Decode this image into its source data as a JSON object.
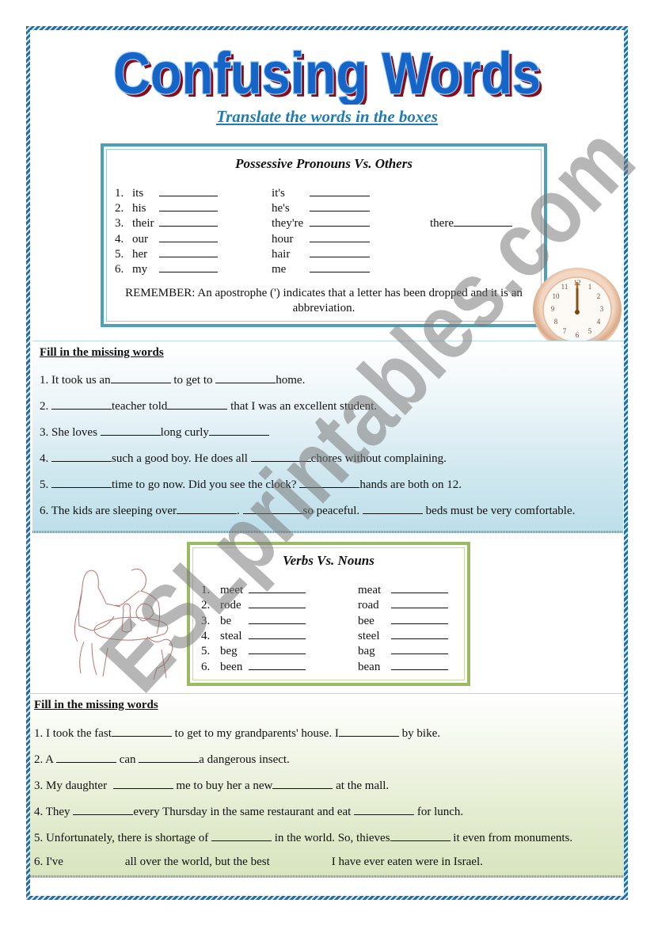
{
  "title": "Confusing Words",
  "subtitle": "Translate the words in the boxes",
  "box1": {
    "heading": "Possessive Pronouns Vs. Others",
    "rows": [
      {
        "num": "1.",
        "left": "its",
        "right": "it's",
        "extra": ""
      },
      {
        "num": "2.",
        "left": "his",
        "right": "he's",
        "extra": ""
      },
      {
        "num": "3.",
        "left": "their",
        "right": "they're",
        "extra": "there"
      },
      {
        "num": "4.",
        "left": "our",
        "right": "hour",
        "extra": ""
      },
      {
        "num": "5.",
        "left": "her",
        "right": "hair",
        "extra": ""
      },
      {
        "num": "6.",
        "left": "my",
        "right": "me",
        "extra": ""
      }
    ],
    "remember": "REMEMBER: An apostrophe (') indicates that a letter has been dropped and it is an abbreviation."
  },
  "clock": {
    "icon": "wall-clock-icon",
    "time": "12:00"
  },
  "fill1": {
    "heading": "Fill in the missing words",
    "sentences": [
      [
        "1. It took us an",
        "_",
        " to get to ",
        "_",
        "home."
      ],
      [
        "2. ",
        "_",
        "teacher told",
        "_",
        " that I was an excellent student."
      ],
      [
        "3. She loves ",
        "_",
        "long curly",
        "_"
      ],
      [
        "4. ",
        "_",
        "such a good boy. He does all ",
        "_",
        "chores without complaining."
      ],
      [
        "5. ",
        "_",
        "time to go now. Did you see the clock? ",
        "_",
        "hands are both on 12."
      ],
      [
        "6. The kids are sleeping over",
        "_",
        ". ",
        "_",
        "so peaceful. ",
        "_",
        " beds must be very comfortable."
      ]
    ]
  },
  "drawing": {
    "icon": "people-at-table-drawing"
  },
  "box2": {
    "heading": "Verbs Vs. Nouns",
    "rows": [
      {
        "num": "1.",
        "left": "meet",
        "right": "meat"
      },
      {
        "num": "2.",
        "left": "rode",
        "right": "road"
      },
      {
        "num": "3.",
        "left": "be",
        "right": "bee"
      },
      {
        "num": "4.",
        "left": "steal",
        "right": "steel"
      },
      {
        "num": "5.",
        "left": "beg",
        "right": "bag"
      },
      {
        "num": "6.",
        "left": "been",
        "right": "bean"
      }
    ]
  },
  "fill2": {
    "heading": "Fill in the missing words",
    "sentences": [
      [
        "1. I took the fast",
        "_",
        " to get to my grandparents' house. I",
        "_",
        " by bike."
      ],
      [
        "2. A ",
        "_",
        " can ",
        "_",
        "a dangerous insect."
      ],
      [
        "3. My daughter  ",
        "_",
        " me to buy her a new",
        "_",
        " at the mall."
      ],
      [
        "4. They ",
        "_",
        "every Thursday in the same restaurant and eat ",
        "_",
        " for lunch."
      ],
      [
        "5. Unfortunately, there is shortage of ",
        "_",
        " in the world. So, thieves",
        "_",
        " it even from monuments."
      ],
      [
        "6. I've",
        " ",
        "all over the world, but the best",
        " ",
        "I have ever eaten were in Israel."
      ]
    ]
  },
  "watermark": "ESLprintables.com"
}
